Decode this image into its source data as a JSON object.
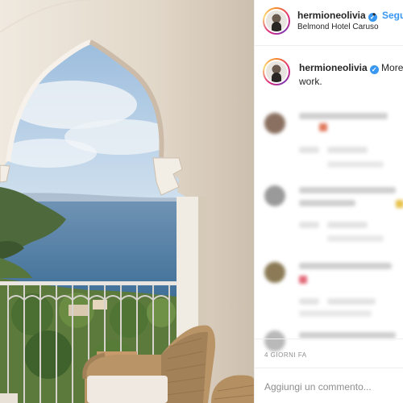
{
  "post": {
    "username": "hermioneolivia",
    "verified": true,
    "follow_label": "Segui",
    "location": "Belmond Hotel Caruso",
    "caption_username": "hermioneolivia",
    "caption_text_line1": "More l",
    "caption_text_line2": "work.",
    "timestamp": "4 GIORNI FA",
    "comment_placeholder": "Aggiungi un commento..."
  },
  "icons": {
    "verified": "verified-badge-icon"
  },
  "colors": {
    "accent": "#3897f0",
    "text": "#262626",
    "muted": "#8e8e8e",
    "border": "#efefef"
  }
}
